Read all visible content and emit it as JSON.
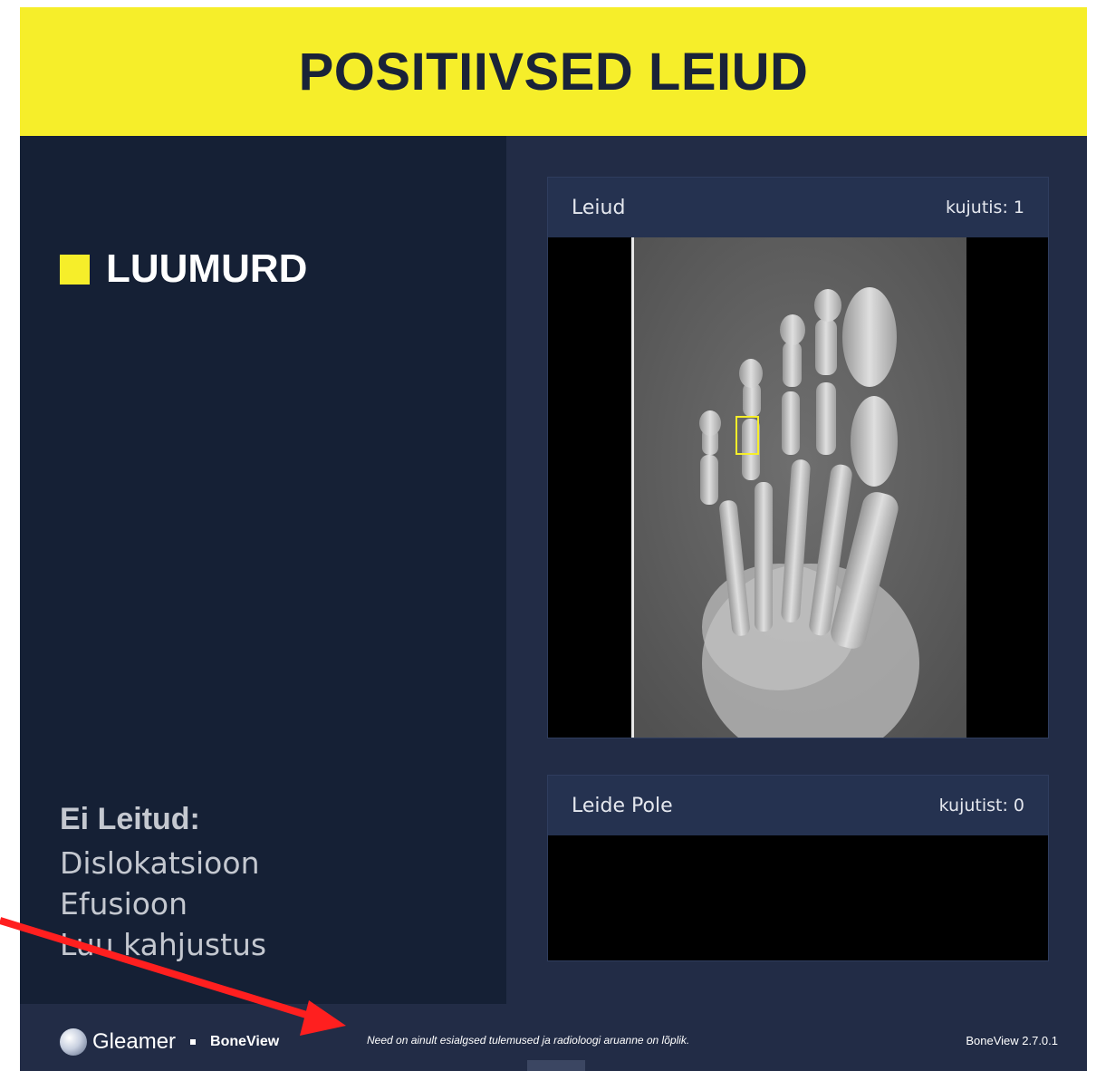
{
  "header": {
    "title": "POSITIIVSED LEIUD"
  },
  "finding": {
    "label": "LUUMURD",
    "marker_color": "#f6ee2a"
  },
  "not_found": {
    "title": "Ei Leitud:",
    "items": [
      "Dislokatsioon",
      "Efusioon",
      "Luu kahjustus"
    ]
  },
  "findings_card": {
    "title": "Leiud",
    "count": "kujutis: 1"
  },
  "no_findings_card": {
    "title": "Leide Pole",
    "count": "kujutist: 0"
  },
  "footer": {
    "brand": "Gleamer",
    "product": "BoneView",
    "disclaimer": "Need on ainult esialgsed tulemused ja radioloogi aruanne on lõplik.",
    "version": "BoneView 2.7.0.1"
  },
  "colors": {
    "accent": "#f6ee2a",
    "background": "#222c46",
    "panel": "#152035",
    "annotation_arrow": "#ff1f1f"
  }
}
